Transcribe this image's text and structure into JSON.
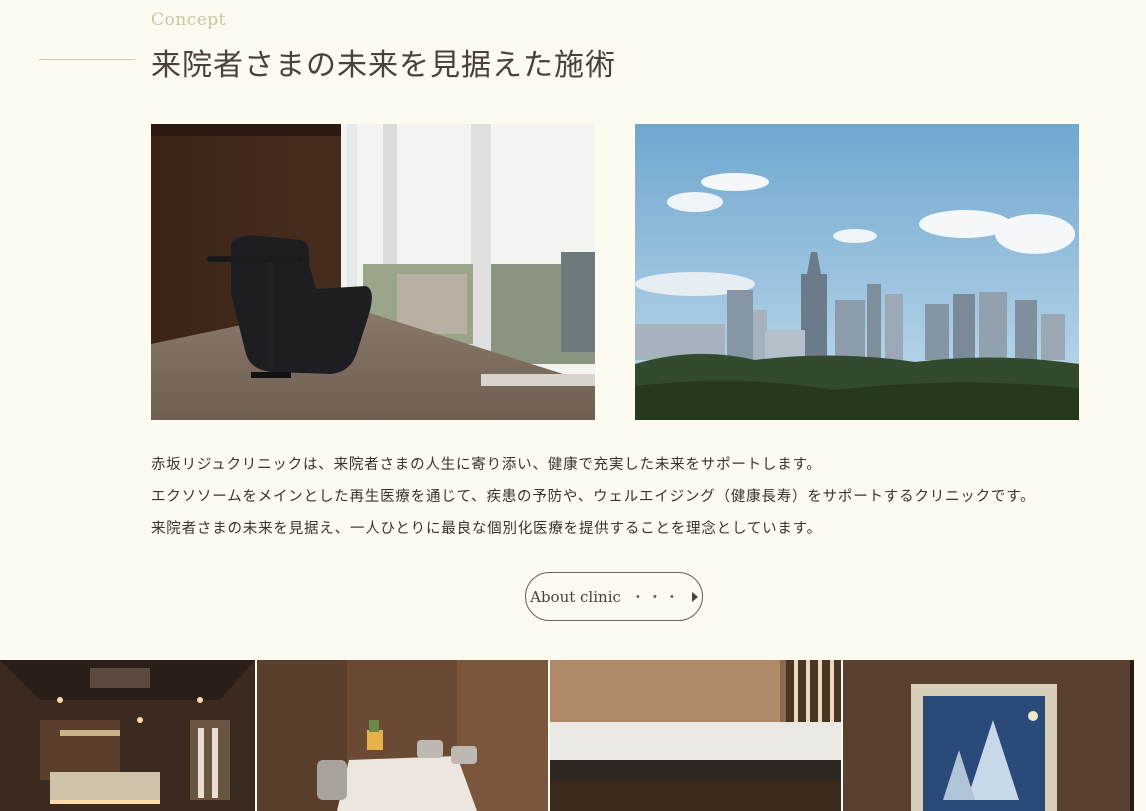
{
  "section": {
    "eyebrow": "Concept",
    "title": "来院者さまの未来を見据えた施術"
  },
  "photos": {
    "lounge_alt": "treatment-lounge-photo",
    "skyline_alt": "city-skyline-photo"
  },
  "body": {
    "lines": [
      "赤坂リジュクリニックは、来院者さまの人生に寄り添い、健康で充実した未来をサポートします。",
      "エクソソームをメインとした再生医療を通じて、疾患の予防や、ウェルエイジング（健康長寿）をサポートするクリニックです。",
      "来院者さまの未来を見据え、一人ひとりに最良な個別化医療を提供することを理念としています。"
    ]
  },
  "button": {
    "label": "About clinic",
    "dots": "・・・",
    "arrow_icon": "triangle-right-icon"
  },
  "gallery": {
    "tiles": [
      "reception-photo",
      "consultation-room-photo",
      "counter-photo",
      "artwork-photo"
    ]
  },
  "colors": {
    "background": "#fdfbf0",
    "eyebrow": "#c9c5a6",
    "text": "#3a332b",
    "rule": "#cfcbb0"
  }
}
